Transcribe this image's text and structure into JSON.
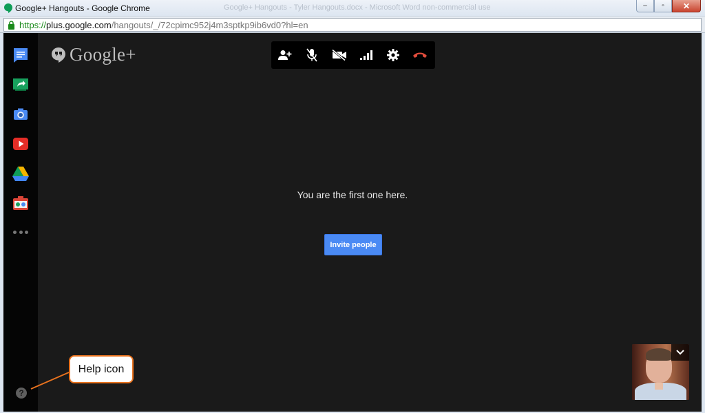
{
  "window": {
    "title": "Google+ Hangouts - Google Chrome",
    "background_title": "Google+ Hangouts - Tyler Hangouts.docx - Microsoft Word non-commercial use",
    "buttons": [
      "minimize",
      "maximize",
      "close"
    ]
  },
  "address_bar": {
    "scheme": "https://",
    "host": "plus.google.com",
    "path": "/hangouts/_/72cpimc952j4m3sptkp9ib6vd0?hl=en"
  },
  "sidebar": {
    "items": [
      {
        "icon": "chat-icon",
        "color": "#4a8af4"
      },
      {
        "icon": "screenshare-icon",
        "color": "#17a05d"
      },
      {
        "icon": "camera-icon",
        "color": "#4a8af4"
      },
      {
        "icon": "youtube-icon",
        "color": "#e52d27"
      },
      {
        "icon": "drive-icon",
        "color": "#f4b400"
      },
      {
        "icon": "effects-icon",
        "color": "#db4437"
      }
    ],
    "more": "more-icon",
    "help_symbol": "?"
  },
  "brand": {
    "name": "Google+"
  },
  "toolbar": {
    "items": [
      "invite-person-icon",
      "mute-mic-icon",
      "video-off-icon",
      "bandwidth-icon",
      "settings-icon",
      "hang-up-icon"
    ],
    "hangup_color": "#e24c3c"
  },
  "main": {
    "message": "You are the first one here.",
    "invite_button": "Invite people"
  },
  "annotation": {
    "label": "Help icon",
    "color": "#e8721e"
  }
}
